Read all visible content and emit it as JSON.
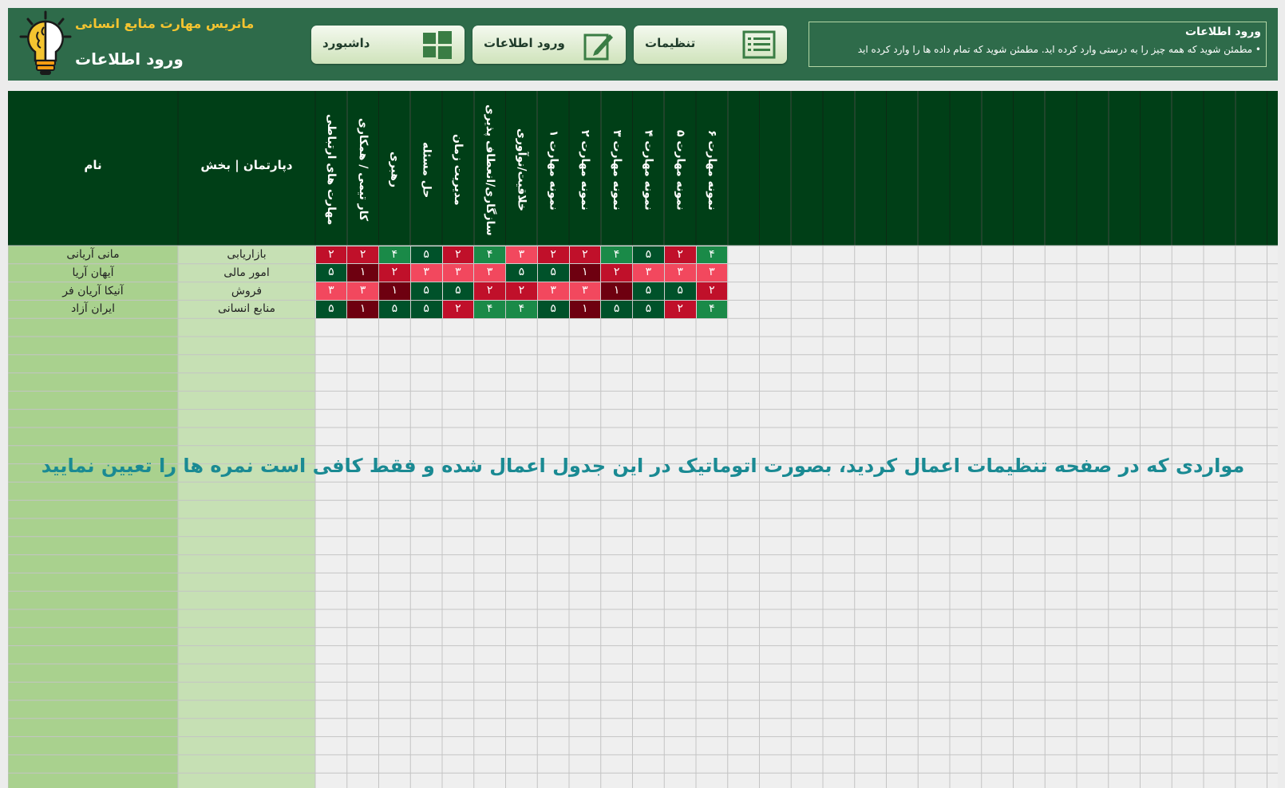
{
  "header": {
    "app_subtitle": "ماتریس مهارت منابع انسانی",
    "page_title": "ورود اطلاعات",
    "nav": {
      "dashboard_label": "داشبورد",
      "data_entry_label": "ورود اطلاعات",
      "settings_label": "تنظیمات"
    },
    "info": {
      "title": "ورود اطلاعات",
      "text": "• مطمئن شوید که همه چیز را به درستی وارد کرده اید. مطمئن شوید که تمام داده ها را وارد کرده اید"
    }
  },
  "table": {
    "name_header": "نام",
    "dept_header": "دپارتمان | بخش",
    "skills": [
      "مهارت های ارتباطی",
      "کار تیمی / همکاری",
      "رهبری",
      "حل مسئله",
      "مدیریت زمان",
      "سازگاری/انعطاف پذیری",
      "خلاقیت/نوآوری",
      "نمونه مهارت ۱",
      "نمونه مهارت ۲",
      "نمونه مهارت ۳",
      "نمونه مهارت ۴",
      "نمونه مهارت ۵",
      "نمونه مهارت ۶"
    ],
    "rows": [
      {
        "name": "مانی آریانی",
        "department": "بازاریابی",
        "scores": [
          2,
          2,
          4,
          5,
          2,
          4,
          3,
          2,
          2,
          4,
          5,
          2,
          4
        ]
      },
      {
        "name": "آیهان آریا",
        "department": "امور مالی",
        "scores": [
          5,
          1,
          2,
          3,
          3,
          3,
          5,
          5,
          1,
          2,
          3,
          3,
          3
        ]
      },
      {
        "name": "آنیکا آریان فر",
        "department": "فروش",
        "scores": [
          3,
          3,
          1,
          5,
          5,
          2,
          2,
          3,
          3,
          1,
          5,
          5,
          2
        ]
      },
      {
        "name": "ایران آزاد",
        "department": "منابع انسانی",
        "scores": [
          5,
          1,
          5,
          5,
          2,
          4,
          4,
          5,
          1,
          5,
          5,
          2,
          4
        ]
      }
    ]
  },
  "overlay_note": "مواردی که در صفحه تنظیمات اعمال کردید، بصورت اتوماتیک در این جدول اعمال شده و فقط کافی است نمره ها را تعیین نمایید",
  "colors": {
    "header_bg": "#2e6b4a",
    "table_header_bg": "#003f17",
    "name_col_bg": "#a9d18e",
    "dept_col_bg": "#c6e0b4",
    "score_1": "#6e0010",
    "score_2": "#c0102a",
    "score_3": "#f2485e",
    "score_4": "#1a8a48",
    "score_5": "#00522a",
    "note_text": "#1a8a93",
    "accent_yellow": "#f4c430"
  },
  "icons": {
    "logo": "lightbulb-brain-icon",
    "dashboard": "windows-grid-icon",
    "data_entry": "pencil-edit-icon",
    "settings": "list-icon"
  }
}
